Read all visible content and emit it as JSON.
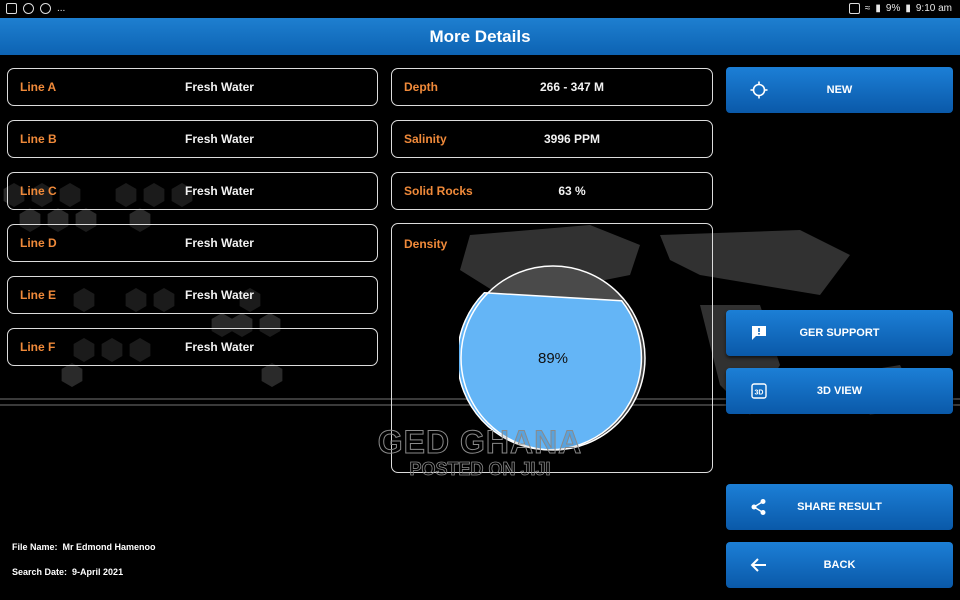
{
  "statusbar": {
    "icons_left": [
      "image-icon",
      "settings-icon",
      "compass-icon"
    ],
    "more": "...",
    "battery": "9%",
    "time": "9:10 am"
  },
  "header": {
    "title": "More Details"
  },
  "lines": [
    {
      "label": "Line A",
      "value": "Fresh Water"
    },
    {
      "label": "Line B",
      "value": "Fresh Water"
    },
    {
      "label": "Line C",
      "value": "Fresh Water"
    },
    {
      "label": "Line D",
      "value": "Fresh Water"
    },
    {
      "label": "Line E",
      "value": "Fresh Water"
    },
    {
      "label": "Line F",
      "value": "Fresh Water"
    }
  ],
  "details": [
    {
      "label": "Depth",
      "value": "266 - 347 M"
    },
    {
      "label": "Salinity",
      "value": "3996 PPM"
    },
    {
      "label": "Solid Rocks",
      "value": "63 %"
    }
  ],
  "density": {
    "label": "Density",
    "percent_text": "89%",
    "fraction": 0.89,
    "fill_color": "#64b5f6",
    "rest_color": "#4a4a4a"
  },
  "buttons": {
    "new": "NEW",
    "support": "GER SUPPORT",
    "view3d": "3D VIEW",
    "share": "SHARE RESULT",
    "back": "BACK"
  },
  "watermark": {
    "line1": "GED GHANA",
    "line2": "POSTED ON JIJI"
  },
  "footer": {
    "file_label": "File Name:",
    "file_value": "Mr Edmond Hamenoo",
    "date_label": "Search Date:",
    "date_value": "9-April 2021"
  },
  "colors": {
    "accent": "#1479cf",
    "label_orange": "#f08a3a"
  }
}
